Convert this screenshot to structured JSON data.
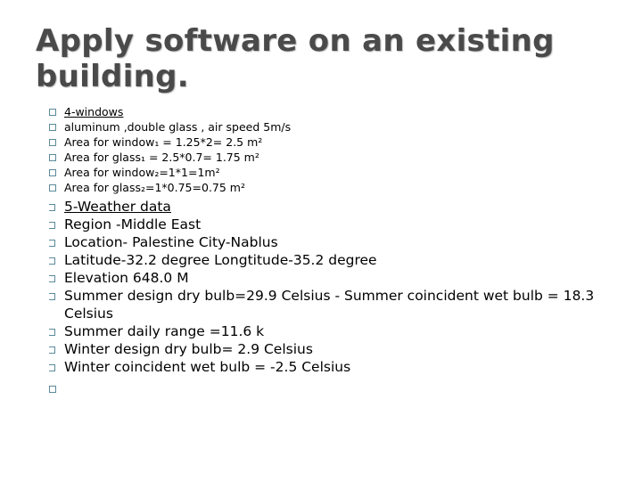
{
  "slide": {
    "title": "Apply software on an existing building.",
    "window_section": {
      "heading": "4-windows",
      "items": [
        "aluminum ,double glass , air speed 5m/s",
        "Area for window₁ = 1.25*2= 2.5 m²",
        "Area for glass₁ = 2.5*0.7= 1.75 m²",
        "Area for window₂=1*1=1m²",
        "Area for glass₂=1*0.75=0.75 m²"
      ]
    },
    "weather_section": {
      "heading": "5-Weather data",
      "items": [
        "Region -Middle East",
        "Location- Palestine  City-Nablus",
        "Latitude-32.2 degree Longtitude-35.2 degree",
        "Elevation 648.0 M",
        "Summer design dry bulb=29.9 Celsius - Summer coincident wet bulb = 18.3 Celsius",
        "Summer daily range =11.6 k",
        "Winter design dry bulb= 2.9 Celsius",
        "Winter coincident wet bulb = -2.5 Celsius",
        ""
      ]
    },
    "bullet_color": "#5b8a9a",
    "title_color": "#4a4a4a"
  }
}
